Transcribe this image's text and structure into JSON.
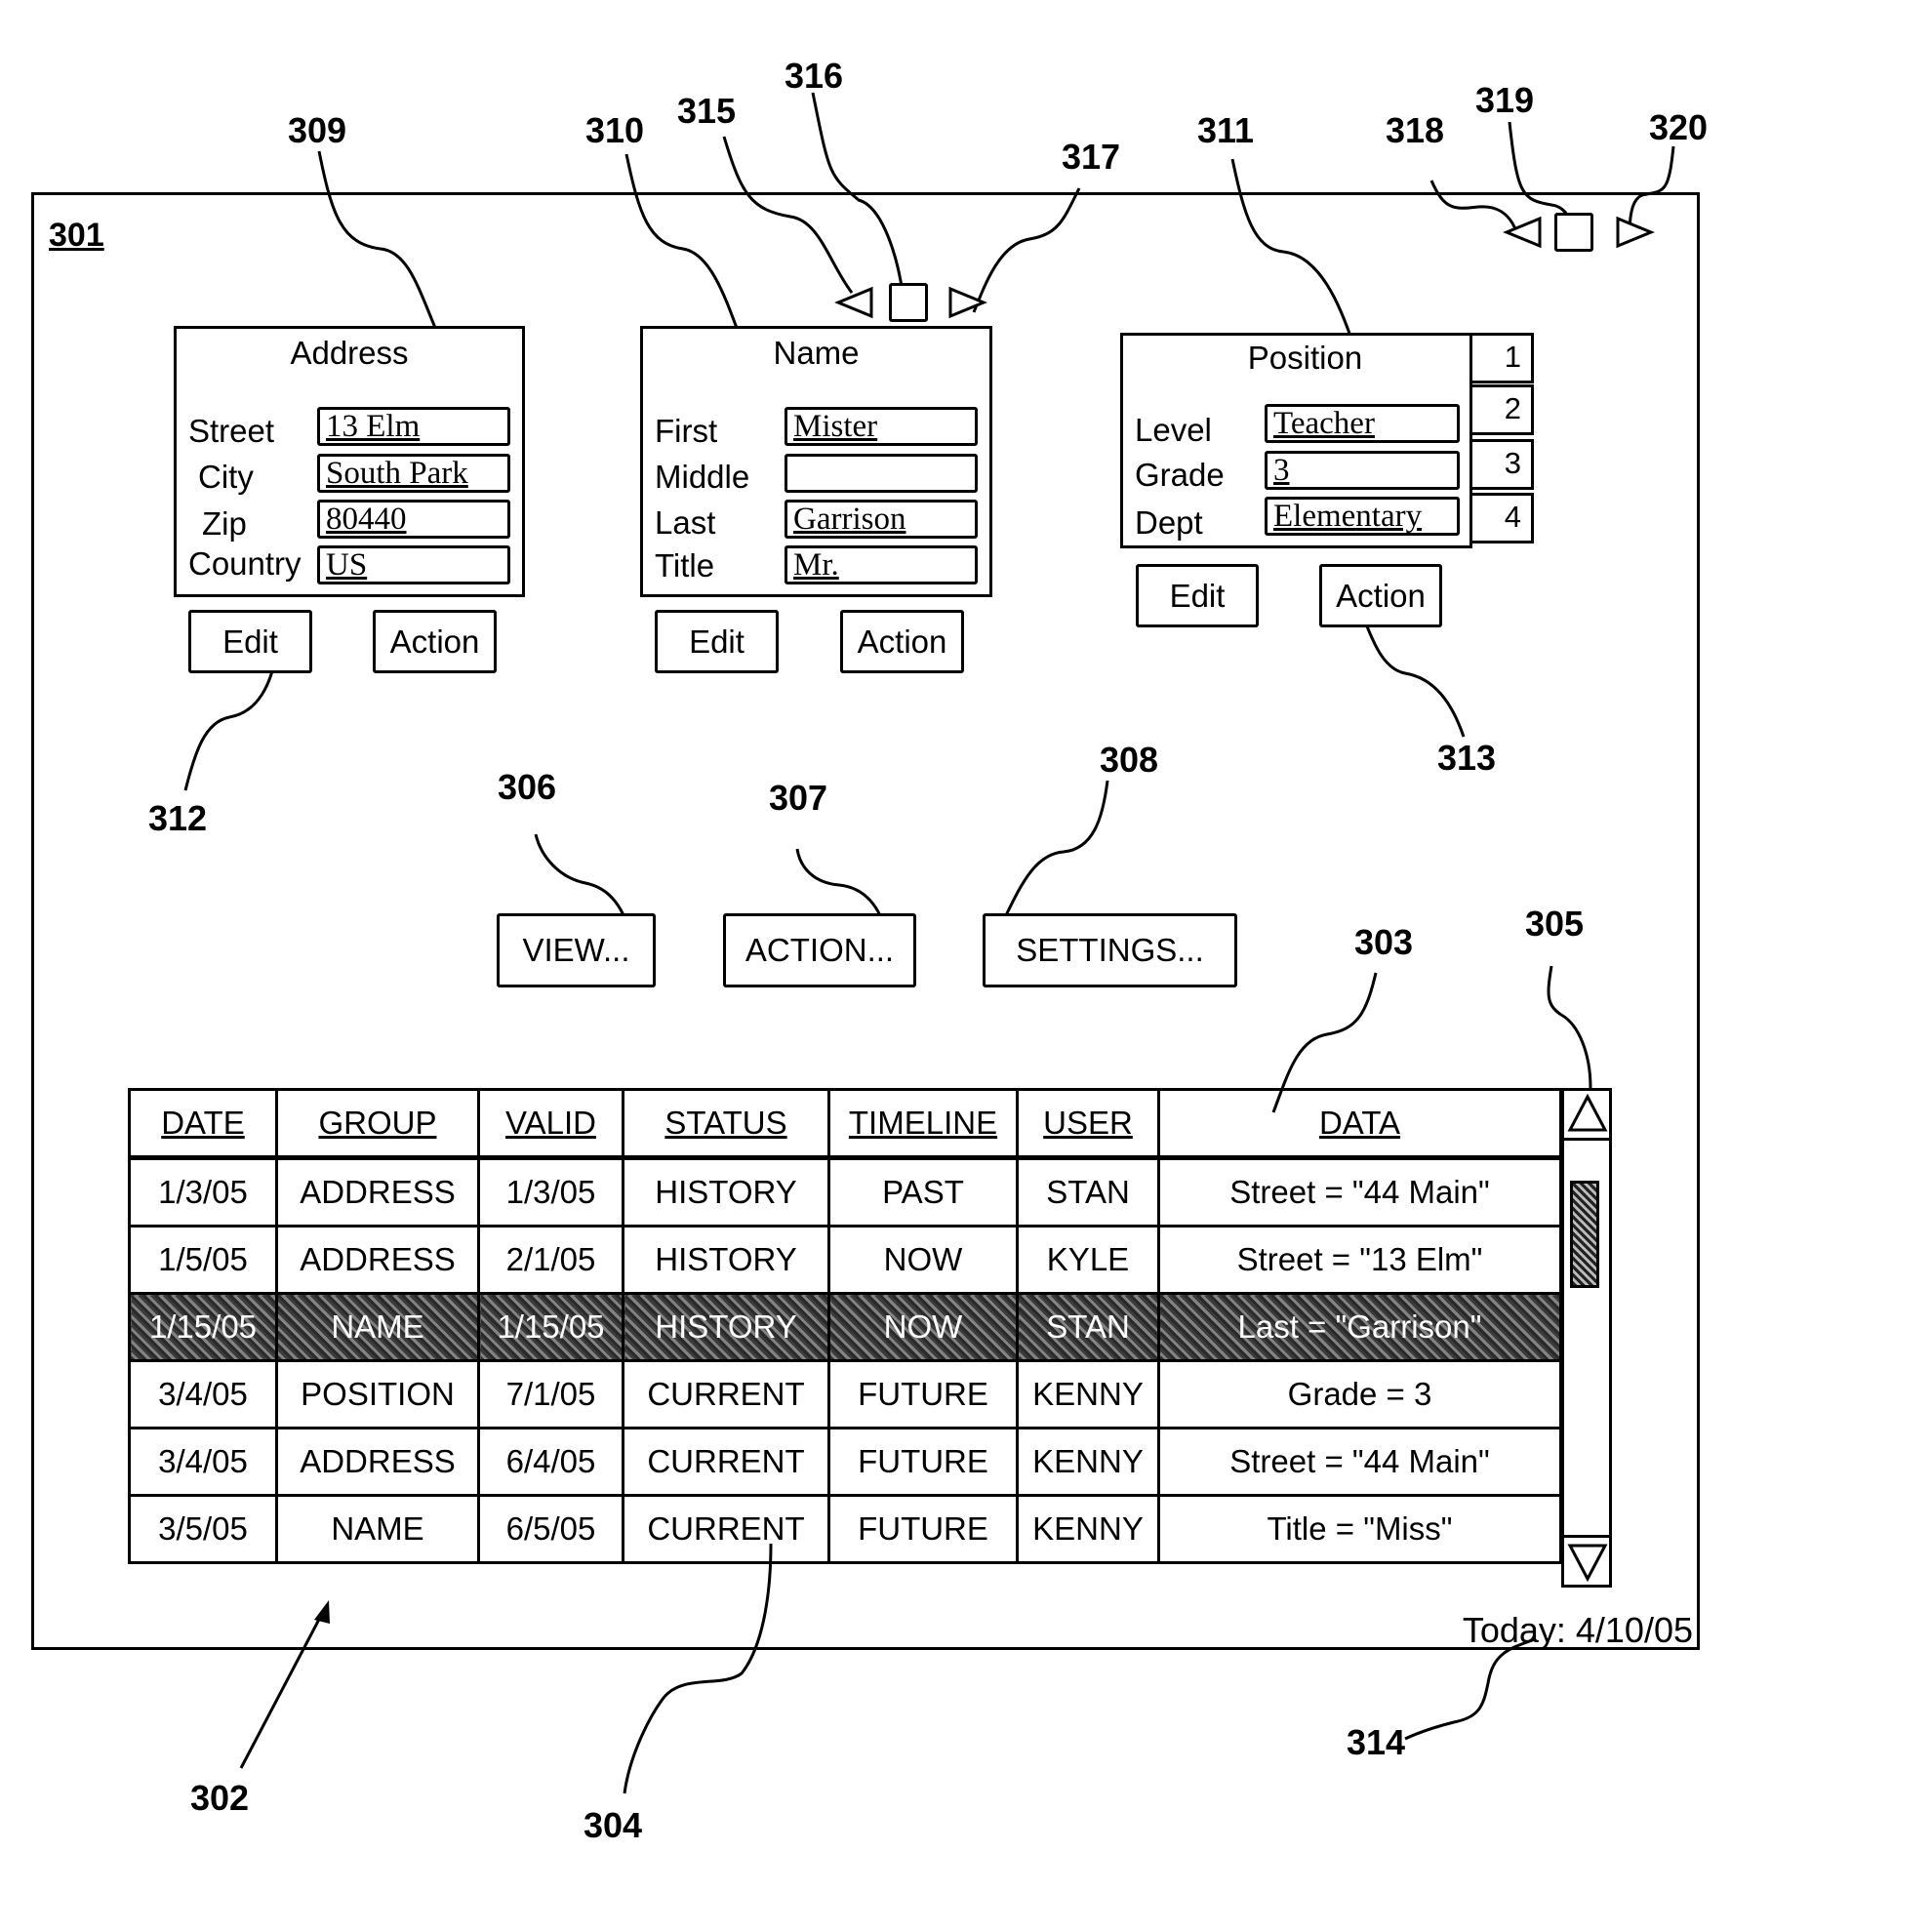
{
  "figure": {
    "window_ref": "301",
    "reference_numerals": {
      "table": "302",
      "data_column": "303",
      "status_cell": "304",
      "scrollbar": "305",
      "view_button": "306",
      "action_button": "307",
      "settings_button": "308",
      "address_panel": "309",
      "name_panel": "310",
      "position_panel": "311",
      "address_edit_button": "312",
      "position_action_button": "313",
      "today_label": "314",
      "name_prev": "315",
      "name_stop": "316",
      "name_next": "317",
      "window_prev": "318",
      "window_stop": "319",
      "window_next": "320"
    }
  },
  "address_panel": {
    "title": "Address",
    "fields": [
      {
        "label": "Street",
        "value": "13 Elm"
      },
      {
        "label": "City",
        "value": "South Park"
      },
      {
        "label": "Zip",
        "value": "80440"
      },
      {
        "label": "Country",
        "value": "US"
      }
    ],
    "edit_label": "Edit",
    "action_label": "Action"
  },
  "name_panel": {
    "title": "Name",
    "fields": [
      {
        "label": "First",
        "value": "Mister"
      },
      {
        "label": "Middle",
        "value": ""
      },
      {
        "label": "Last",
        "value": "Garrison"
      },
      {
        "label": "Title",
        "value": "Mr."
      }
    ],
    "edit_label": "Edit",
    "action_label": "Action"
  },
  "position_panel": {
    "title": "Position",
    "fields": [
      {
        "label": "Level",
        "value": "Teacher"
      },
      {
        "label": "Grade",
        "value": "3"
      },
      {
        "label": "Dept",
        "value": "Elementary"
      }
    ],
    "tabs": [
      "1",
      "2",
      "3",
      "4"
    ],
    "edit_label": "Edit",
    "action_label": "Action"
  },
  "toolbar": {
    "view_label": "VIEW...",
    "action_label": "ACTION...",
    "settings_label": "SETTINGS..."
  },
  "table": {
    "columns": [
      "DATE",
      "GROUP",
      "VALID",
      "STATUS",
      "TIMELINE",
      "USER",
      "DATA"
    ],
    "rows": [
      [
        "1/3/05",
        "ADDRESS",
        "1/3/05",
        "HISTORY",
        "PAST",
        "STAN",
        "Street = \"44 Main\""
      ],
      [
        "1/5/05",
        "ADDRESS",
        "2/1/05",
        "HISTORY",
        "NOW",
        "KYLE",
        "Street = \"13 Elm\""
      ],
      [
        "1/15/05",
        "NAME",
        "1/15/05",
        "HISTORY",
        "NOW",
        "STAN",
        "Last = \"Garrison\""
      ],
      [
        "3/4/05",
        "POSITION",
        "7/1/05",
        "CURRENT",
        "FUTURE",
        "KENNY",
        "Grade = 3"
      ],
      [
        "3/4/05",
        "ADDRESS",
        "6/4/05",
        "CURRENT",
        "FUTURE",
        "KENNY",
        "Street = \"44 Main\""
      ],
      [
        "3/5/05",
        "NAME",
        "6/5/05",
        "CURRENT",
        "FUTURE",
        "KENNY",
        "Title = \"Miss\""
      ]
    ],
    "selected_row_index": 2
  },
  "status": {
    "today_text": "Today: 4/10/05"
  }
}
